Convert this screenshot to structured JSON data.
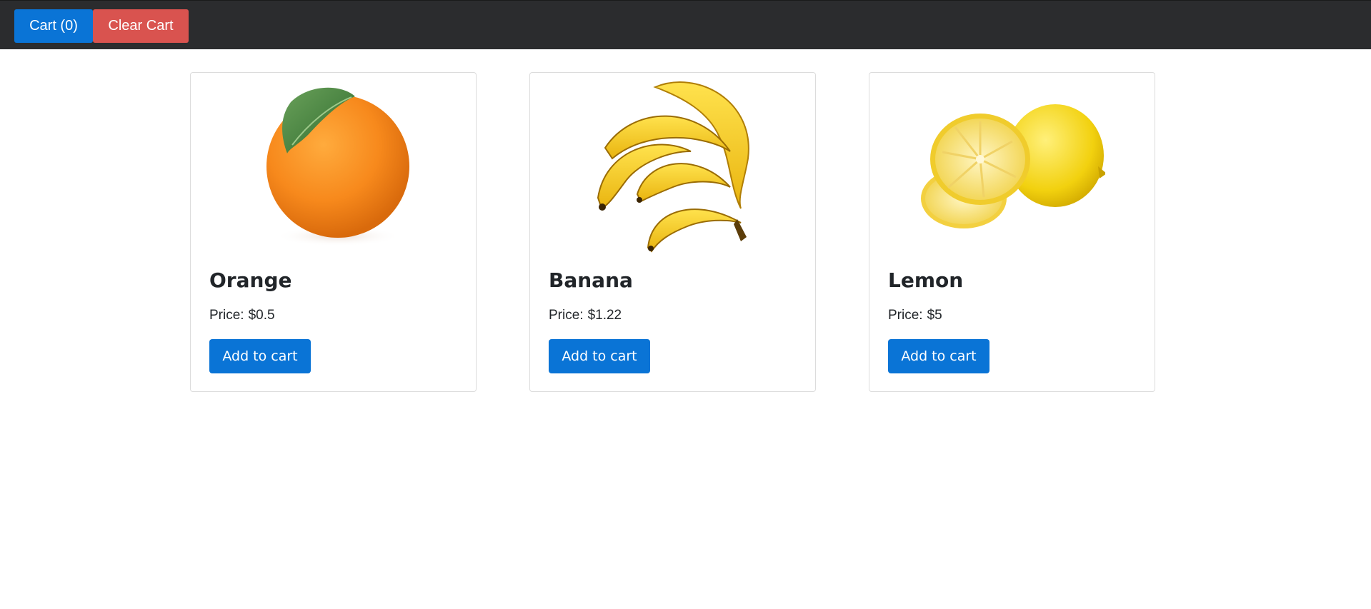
{
  "navbar": {
    "cart_label": "Cart (0)",
    "clear_label": "Clear Cart"
  },
  "products": [
    {
      "name": "Orange",
      "price_label": "Price:",
      "price": "$0.5",
      "button": "Add to cart",
      "image": "orange-image"
    },
    {
      "name": "Banana",
      "price_label": "Price:",
      "price": "$1.22",
      "button": "Add to cart",
      "image": "banana-image"
    },
    {
      "name": "Lemon",
      "price_label": "Price:",
      "price": "$5",
      "button": "Add to cart",
      "image": "lemon-image"
    }
  ],
  "colors": {
    "navbar_bg": "#2b2c2e",
    "primary": "#0a74d6",
    "danger": "#d9534f"
  }
}
